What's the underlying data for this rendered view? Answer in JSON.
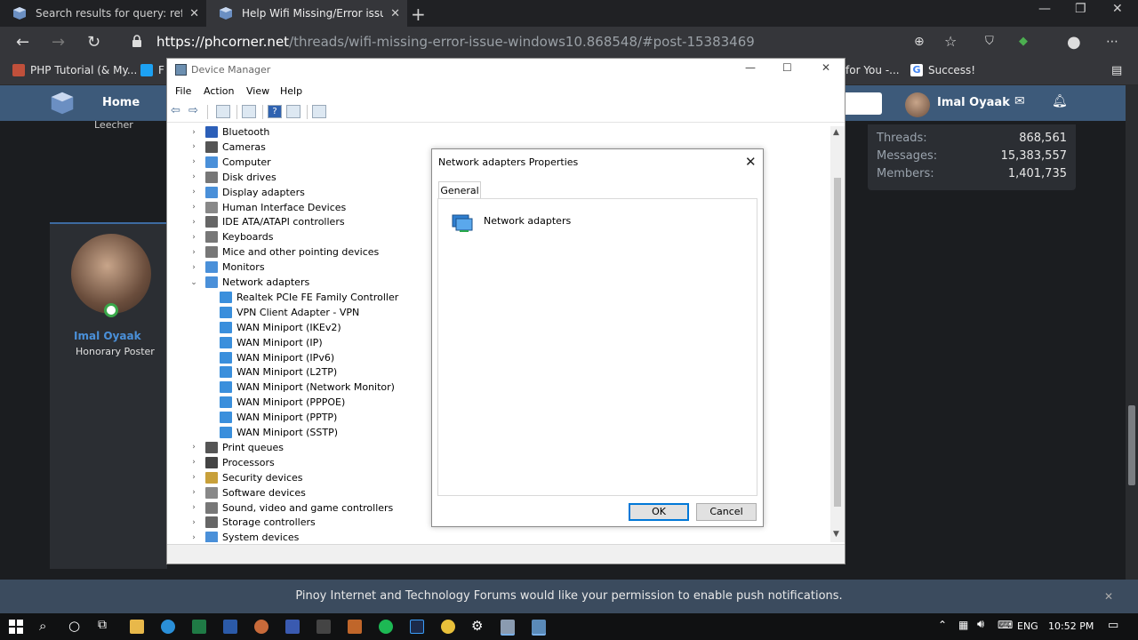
{
  "browser": {
    "tabs": [
      {
        "title": "Search results for query: reforma"
      },
      {
        "title": "Help Wifi Missing/Error issue Wi"
      }
    ],
    "url_scheme": "https://",
    "url_host": "phcorner.net",
    "url_path": "/threads/wifi-missing-error-issue-windows10.868548/#post-15383469",
    "bookmarks": [
      "PHP Tutorial (& My...",
      "F",
      "for You -...",
      "Success!"
    ]
  },
  "site": {
    "nav_home": "Home",
    "user_name": "Imal Oyaak",
    "leecher": "Leecher",
    "poster_name": "Imal Oyaak",
    "poster_title": "Honorary Poster",
    "stats": [
      {
        "label": "Threads:",
        "value": "868,561"
      },
      {
        "label": "Messages:",
        "value": "15,383,557"
      },
      {
        "label": "Members:",
        "value": "1,401,735"
      }
    ],
    "push_text": "Pinoy Internet and Technology Forums would like your permission to enable push notifications."
  },
  "device_manager": {
    "title": "Device Manager",
    "menu": [
      "File",
      "Action",
      "View",
      "Help"
    ],
    "categories": [
      {
        "label": "Bluetooth",
        "expanded": false
      },
      {
        "label": "Cameras",
        "expanded": false
      },
      {
        "label": "Computer",
        "expanded": false
      },
      {
        "label": "Disk drives",
        "expanded": false
      },
      {
        "label": "Display adapters",
        "expanded": false
      },
      {
        "label": "Human Interface Devices",
        "expanded": false
      },
      {
        "label": "IDE ATA/ATAPI controllers",
        "expanded": false
      },
      {
        "label": "Keyboards",
        "expanded": false
      },
      {
        "label": "Mice and other pointing devices",
        "expanded": false
      },
      {
        "label": "Monitors",
        "expanded": false
      },
      {
        "label": "Network adapters",
        "expanded": true
      }
    ],
    "network_children": [
      "Realtek PCIe FE Family Controller",
      "VPN Client Adapter - VPN",
      "WAN Miniport (IKEv2)",
      "WAN Miniport (IP)",
      "WAN Miniport (IPv6)",
      "WAN Miniport (L2TP)",
      "WAN Miniport (Network Monitor)",
      "WAN Miniport (PPPOE)",
      "WAN Miniport (PPTP)",
      "WAN Miniport (SSTP)"
    ],
    "categories_after": [
      "Print queues",
      "Processors",
      "Security devices",
      "Software devices",
      "Sound, video and game controllers",
      "Storage controllers",
      "System devices"
    ]
  },
  "properties_dialog": {
    "title": "Network adapters Properties",
    "tab": "General",
    "item_label": "Network adapters",
    "ok_label": "OK",
    "cancel_label": "Cancel"
  },
  "taskbar": {
    "language": "ENG",
    "time": "10:52 PM"
  },
  "colors": {
    "site_nav": "#3d5a7a",
    "accent_blue": "#0078d7",
    "online_green": "#3aa84a"
  }
}
